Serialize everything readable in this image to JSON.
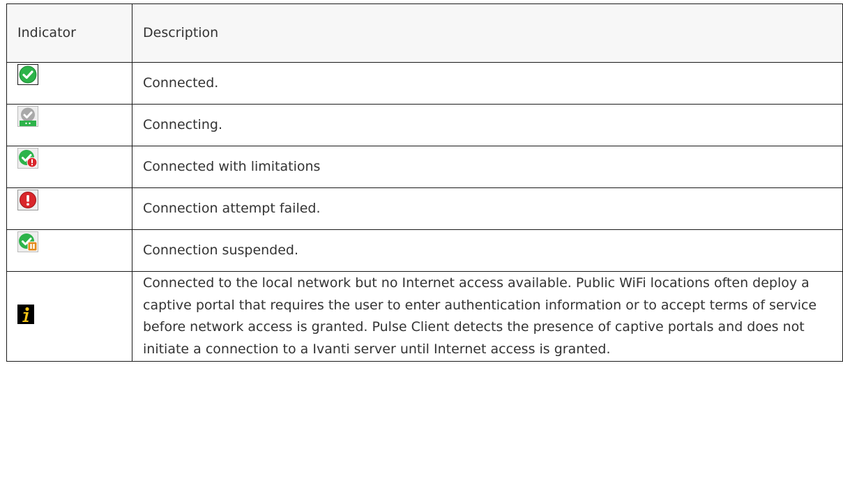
{
  "table": {
    "header": {
      "indicator": "Indicator",
      "description": "Description"
    },
    "rows": [
      {
        "icon": "connected-icon",
        "description": "Connected."
      },
      {
        "icon": "connecting-icon",
        "description": "Connecting."
      },
      {
        "icon": "connected-with-limitations-icon",
        "description": "Connected with limitations"
      },
      {
        "icon": "connection-failed-icon",
        "description": "Connection attempt failed."
      },
      {
        "icon": "connection-suspended-icon",
        "description": "Connection suspended."
      },
      {
        "icon": "info-icon",
        "description": "Connected to the local network but no Internet access available. Public WiFi locations often deploy a captive portal that requires the user to enter authentication information or to accept terms of service before network access is granted. Pulse Client detects the presence of captive portals and does not initiate a connection to a Ivanti server until Internet access is granted."
      }
    ]
  },
  "colors": {
    "green": "#2db34a",
    "gray": "#a9a9a9",
    "red": "#d9262b",
    "orange": "#e38a1c",
    "info_yellow": "#f5c518",
    "border": "#1a1a1a",
    "header_bg": "#f7f7f7"
  }
}
